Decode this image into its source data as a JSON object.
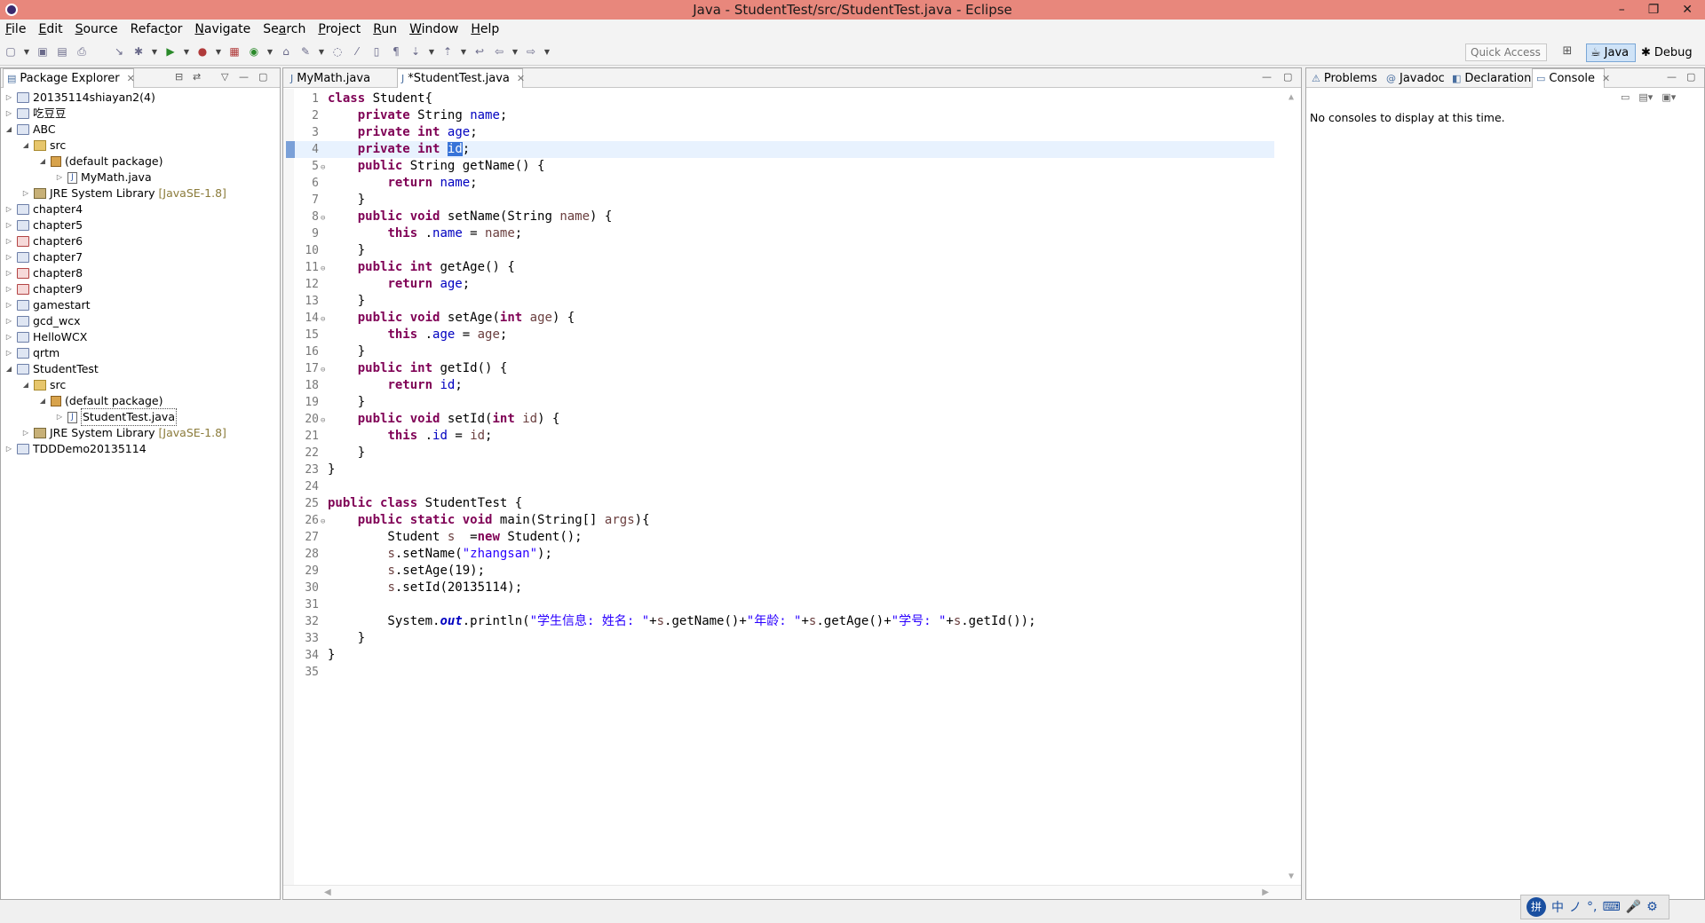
{
  "window": {
    "title": "Java - StudentTest/src/StudentTest.java - Eclipse",
    "minimize": "–",
    "restore": "❐",
    "close": "✕"
  },
  "menubar": {
    "items": [
      {
        "u": "F",
        "rest": "ile"
      },
      {
        "u": "E",
        "rest": "dit"
      },
      {
        "u": "S",
        "rest": "ource"
      },
      {
        "pre": "Refac",
        "u": "t",
        "rest": "or"
      },
      {
        "u": "N",
        "rest": "avigate"
      },
      {
        "pre": "Se",
        "u": "a",
        "rest": "rch"
      },
      {
        "u": "P",
        "rest": "roject"
      },
      {
        "u": "R",
        "rest": "un"
      },
      {
        "u": "W",
        "rest": "indow"
      },
      {
        "u": "H",
        "rest": "elp"
      }
    ]
  },
  "toolbar": {
    "quick_access_placeholder": "Quick Access",
    "perspectives": [
      "Java",
      "Debug"
    ]
  },
  "package_explorer": {
    "tab_label": "Package Explorer",
    "items": [
      {
        "label": "20135114shiayan2(4)",
        "depth": 0,
        "expanded": false,
        "kind": "project"
      },
      {
        "label": "吃豆豆",
        "depth": 0,
        "expanded": false,
        "kind": "project"
      },
      {
        "label": "ABC",
        "depth": 0,
        "expanded": true,
        "kind": "project"
      },
      {
        "label": "src",
        "depth": 1,
        "expanded": true,
        "kind": "src"
      },
      {
        "label": "(default package)",
        "depth": 2,
        "expanded": true,
        "kind": "package"
      },
      {
        "label": "MyMath.java",
        "depth": 3,
        "expanded": false,
        "kind": "java"
      },
      {
        "label": "JRE System Library",
        "version": "[JavaSE-1.8]",
        "depth": 1,
        "expanded": false,
        "kind": "lib"
      },
      {
        "label": "chapter4",
        "depth": 0,
        "expanded": false,
        "kind": "project"
      },
      {
        "label": "chapter5",
        "depth": 0,
        "expanded": false,
        "kind": "project"
      },
      {
        "label": "chapter6",
        "depth": 0,
        "expanded": false,
        "kind": "project-err"
      },
      {
        "label": "chapter7",
        "depth": 0,
        "expanded": false,
        "kind": "project"
      },
      {
        "label": "chapter8",
        "depth": 0,
        "expanded": false,
        "kind": "project-err"
      },
      {
        "label": "chapter9",
        "depth": 0,
        "expanded": false,
        "kind": "project-err"
      },
      {
        "label": "gamestart",
        "depth": 0,
        "expanded": false,
        "kind": "project"
      },
      {
        "label": "gcd_wcx",
        "depth": 0,
        "expanded": false,
        "kind": "project"
      },
      {
        "label": "HelloWCX",
        "depth": 0,
        "expanded": false,
        "kind": "project"
      },
      {
        "label": "qrtm",
        "depth": 0,
        "expanded": false,
        "kind": "project"
      },
      {
        "label": "StudentTest",
        "depth": 0,
        "expanded": true,
        "kind": "project"
      },
      {
        "label": "src",
        "depth": 1,
        "expanded": true,
        "kind": "src"
      },
      {
        "label": "(default package)",
        "depth": 2,
        "expanded": true,
        "kind": "package"
      },
      {
        "label": "StudentTest.java",
        "depth": 3,
        "expanded": false,
        "kind": "java",
        "selected": true
      },
      {
        "label": "JRE System Library",
        "version": "[JavaSE-1.8]",
        "depth": 1,
        "expanded": false,
        "kind": "lib"
      },
      {
        "label": "TDDDemo20135114",
        "depth": 0,
        "expanded": false,
        "kind": "project"
      }
    ]
  },
  "editor": {
    "tabs": [
      {
        "label": "MyMath.java",
        "active": false
      },
      {
        "label": "*StudentTest.java",
        "active": true
      }
    ],
    "current_line": 4,
    "lines": [
      {
        "n": "1",
        "tokens": [
          [
            "kw",
            "class"
          ],
          [
            "",
            "Student{"
          ]
        ]
      },
      {
        "n": "2",
        "tokens": [
          [
            "",
            "    "
          ],
          [
            "kw",
            "private"
          ],
          [
            "",
            "String "
          ],
          [
            "field",
            "name"
          ],
          [
            "",
            ";"
          ]
        ]
      },
      {
        "n": "3",
        "tokens": [
          [
            "",
            "    "
          ],
          [
            "kw",
            "private"
          ],
          [
            "",
            ""
          ],
          [
            "kw",
            "int"
          ],
          [
            "",
            ""
          ],
          [
            "field",
            "age"
          ],
          [
            "",
            ";"
          ]
        ]
      },
      {
        "n": "4",
        "tokens": [
          [
            "",
            "    "
          ],
          [
            "kw",
            "private"
          ],
          [
            "",
            ""
          ],
          [
            "kw",
            "int"
          ],
          [
            "",
            ""
          ],
          [
            "hl",
            "id"
          ],
          [
            "",
            ";"
          ]
        ]
      },
      {
        "n": "5",
        "fold": true,
        "tokens": [
          [
            "",
            "    "
          ],
          [
            "kw",
            "public"
          ],
          [
            "",
            "String getName() {"
          ]
        ]
      },
      {
        "n": "6",
        "tokens": [
          [
            "",
            "        "
          ],
          [
            "kw",
            "return"
          ],
          [
            "",
            ""
          ],
          [
            "field",
            "name"
          ],
          [
            "",
            ";"
          ]
        ]
      },
      {
        "n": "7",
        "tokens": [
          [
            "",
            "    }"
          ]
        ]
      },
      {
        "n": "8",
        "fold": true,
        "tokens": [
          [
            "",
            "    "
          ],
          [
            "kw",
            "public"
          ],
          [
            "",
            ""
          ],
          [
            "kw",
            "void"
          ],
          [
            "",
            "setName(String "
          ],
          [
            "param",
            "name"
          ],
          [
            "",
            ") {"
          ]
        ]
      },
      {
        "n": "9",
        "tokens": [
          [
            "",
            "        "
          ],
          [
            "kw",
            "this"
          ],
          [
            "",
            "."
          ],
          [
            "field",
            "name"
          ],
          [
            "",
            ""
          ],
          [
            "param",
            "name"
          ],
          [
            "",
            ";"
          ]
        ]
      },
      {
        "n": "10",
        "tokens": [
          [
            "",
            "    }"
          ]
        ]
      },
      {
        "n": "11",
        "fold": true,
        "tokens": [
          [
            "",
            "    "
          ],
          [
            "kw",
            "public"
          ],
          [
            "",
            ""
          ],
          [
            "kw",
            "int"
          ],
          [
            "",
            "getAge() {"
          ]
        ]
      },
      {
        "n": "12",
        "tokens": [
          [
            "",
            "        "
          ],
          [
            "kw",
            "return"
          ],
          [
            "",
            ""
          ],
          [
            "field",
            "age"
          ],
          [
            "",
            ";"
          ]
        ]
      },
      {
        "n": "13",
        "tokens": [
          [
            "",
            "    }"
          ]
        ]
      },
      {
        "n": "14",
        "fold": true,
        "tokens": [
          [
            "",
            "    "
          ],
          [
            "kw",
            "public"
          ],
          [
            "",
            ""
          ],
          [
            "kw",
            "void"
          ],
          [
            "",
            "setAge("
          ],
          [
            "kw",
            "int"
          ],
          [
            "",
            ""
          ],
          [
            "param",
            "age"
          ],
          [
            "",
            ") {"
          ]
        ]
      },
      {
        "n": "15",
        "tokens": [
          [
            "",
            "        "
          ],
          [
            "kw",
            "this"
          ],
          [
            "",
            "."
          ],
          [
            "field",
            "age"
          ],
          [
            "",
            ""
          ],
          [
            "param",
            "age"
          ],
          [
            "",
            ";"
          ]
        ]
      },
      {
        "n": "16",
        "tokens": [
          [
            "",
            "    }"
          ]
        ]
      },
      {
        "n": "17",
        "fold": true,
        "tokens": [
          [
            "",
            "    "
          ],
          [
            "kw",
            "public"
          ],
          [
            "",
            ""
          ],
          [
            "kw",
            "int"
          ],
          [
            "",
            "getId() {"
          ]
        ]
      },
      {
        "n": "18",
        "tokens": [
          [
            "",
            "        "
          ],
          [
            "kw",
            "return"
          ],
          [
            "",
            ""
          ],
          [
            "field",
            "id"
          ],
          [
            "",
            ";"
          ]
        ]
      },
      {
        "n": "19",
        "tokens": [
          [
            "",
            "    }"
          ]
        ]
      },
      {
        "n": "20",
        "fold": true,
        "tokens": [
          [
            "",
            "    "
          ],
          [
            "kw",
            "public"
          ],
          [
            "",
            ""
          ],
          [
            "kw",
            "void"
          ],
          [
            "",
            "setId("
          ],
          [
            "kw",
            "int"
          ],
          [
            "",
            ""
          ],
          [
            "param",
            "id"
          ],
          [
            "",
            ") {"
          ]
        ]
      },
      {
        "n": "21",
        "tokens": [
          [
            "",
            "        "
          ],
          [
            "kw",
            "this"
          ],
          [
            "",
            "."
          ],
          [
            "field",
            "id"
          ],
          [
            "",
            ""
          ],
          [
            "param",
            "id"
          ],
          [
            "",
            ";"
          ]
        ]
      },
      {
        "n": "22",
        "tokens": [
          [
            "",
            "    }"
          ]
        ]
      },
      {
        "n": "23",
        "tokens": [
          [
            "",
            "}"
          ]
        ]
      },
      {
        "n": "24",
        "tokens": []
      },
      {
        "n": "25",
        "tokens": [
          [
            "kw",
            "public"
          ],
          [
            "",
            ""
          ],
          [
            "kw",
            "class"
          ],
          [
            "",
            "StudentTest {"
          ]
        ]
      },
      {
        "n": "26",
        "fold": true,
        "tokens": [
          [
            "",
            "    "
          ],
          [
            "kw",
            "public"
          ],
          [
            "",
            ""
          ],
          [
            "kw",
            "static"
          ],
          [
            "",
            ""
          ],
          [
            "kw",
            "void"
          ],
          [
            "",
            "main(String[] "
          ],
          [
            "param",
            "args"
          ],
          [
            "",
            "){"
          ]
        ]
      },
      {
        "n": "27",
        "tokens": [
          [
            "",
            "        Student "
          ],
          [
            "param",
            "s"
          ],
          [
            "",
            ""
          ],
          [
            "kw",
            "new"
          ],
          [
            "",
            "Student();"
          ]
        ]
      },
      {
        "n": "28",
        "tokens": [
          [
            "",
            "        "
          ],
          [
            "param",
            "s"
          ],
          [
            "",
            ".setName("
          ],
          [
            "str",
            "\"zhangsan\""
          ],
          [
            "",
            ");"
          ]
        ]
      },
      {
        "n": "29",
        "tokens": [
          [
            "",
            "        "
          ],
          [
            "param",
            "s"
          ],
          [
            "",
            ".setAge(19);"
          ]
        ]
      },
      {
        "n": "30",
        "tokens": [
          [
            "",
            "        "
          ],
          [
            "param",
            "s"
          ],
          [
            "",
            ".setId(20135114);"
          ]
        ]
      },
      {
        "n": "31",
        "tokens": []
      },
      {
        "n": "32",
        "tokens": [
          [
            "",
            "        System."
          ],
          [
            "static",
            "out"
          ],
          [
            "",
            ".println("
          ],
          [
            "str",
            "\"学生信息: 姓名: \""
          ],
          [
            "",
            "+"
          ],
          [
            "param",
            "s"
          ],
          [
            "",
            ".getName()+"
          ],
          [
            "str",
            "\"年龄: \""
          ],
          [
            "",
            "+"
          ],
          [
            "param",
            "s"
          ],
          [
            "",
            ".getAge()+"
          ],
          [
            "str",
            "\"学号: \""
          ],
          [
            "",
            "+"
          ],
          [
            "param",
            "s"
          ],
          [
            "",
            ".getId());"
          ]
        ]
      },
      {
        "n": "33",
        "tokens": [
          [
            "",
            "    }"
          ]
        ]
      },
      {
        "n": "34",
        "tokens": [
          [
            "",
            "}"
          ]
        ]
      },
      {
        "n": "35",
        "tokens": []
      }
    ]
  },
  "right_panel": {
    "tabs": [
      {
        "label": "Problems",
        "icon": "problems-icon"
      },
      {
        "label": "Javadoc",
        "icon": "javadoc-icon"
      },
      {
        "label": "Declaration",
        "icon": "declaration-icon"
      },
      {
        "label": "Console",
        "icon": "console-icon",
        "active": true
      }
    ],
    "console_message": "No consoles to display at this time."
  },
  "tray": {
    "items": [
      "中",
      "ノ",
      "°,",
      "⌨",
      "🎤",
      "⚙"
    ]
  }
}
